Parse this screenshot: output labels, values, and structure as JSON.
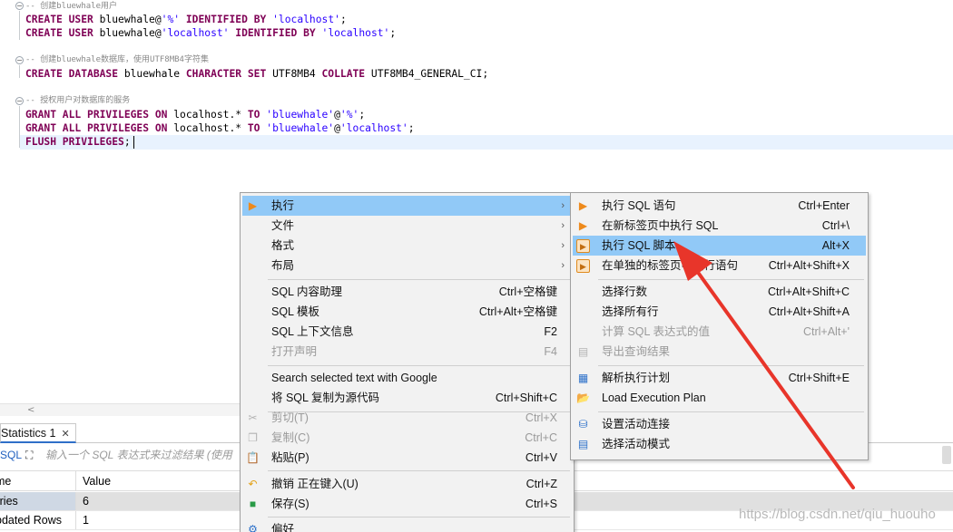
{
  "editor": {
    "lines": [
      {
        "segs": [
          {
            "t": "-- 创建bluewhale用户",
            "c": "cm"
          }
        ]
      },
      {
        "segs": [
          {
            "t": "CREATE USER",
            "c": "kw"
          },
          {
            "t": " bluewhale@",
            "c": ""
          },
          {
            "t": "'%'",
            "c": "str"
          },
          {
            "t": " ",
            "c": ""
          },
          {
            "t": "IDENTIFIED BY",
            "c": "kw"
          },
          {
            "t": " ",
            "c": ""
          },
          {
            "t": "'localhost'",
            "c": "str"
          },
          {
            "t": ";",
            "c": ""
          }
        ]
      },
      {
        "segs": [
          {
            "t": "CREATE USER",
            "c": "kw"
          },
          {
            "t": " bluewhale@",
            "c": ""
          },
          {
            "t": "'localhost'",
            "c": "str"
          },
          {
            "t": " ",
            "c": ""
          },
          {
            "t": "IDENTIFIED BY",
            "c": "kw"
          },
          {
            "t": " ",
            "c": ""
          },
          {
            "t": "'localhost'",
            "c": "str"
          },
          {
            "t": ";",
            "c": ""
          }
        ]
      },
      {
        "segs": []
      },
      {
        "segs": [
          {
            "t": "-- 创建bluewhale数据库，使用UTF8MB4字符集",
            "c": "cm"
          }
        ]
      },
      {
        "segs": [
          {
            "t": "CREATE DATABASE",
            "c": "kw"
          },
          {
            "t": " bluewhale ",
            "c": ""
          },
          {
            "t": "CHARACTER SET",
            "c": "kw"
          },
          {
            "t": " UTF8MB4 ",
            "c": ""
          },
          {
            "t": "COLLATE",
            "c": "kw"
          },
          {
            "t": " UTF8MB4_GENERAL_CI;",
            "c": ""
          }
        ]
      },
      {
        "segs": []
      },
      {
        "segs": [
          {
            "t": "-- 授权用户对数据库的服务",
            "c": "cm"
          }
        ]
      },
      {
        "segs": [
          {
            "t": "GRANT ALL PRIVILEGES ON",
            "c": "kw"
          },
          {
            "t": " localhost.* ",
            "c": ""
          },
          {
            "t": "TO",
            "c": "kw"
          },
          {
            "t": " ",
            "c": ""
          },
          {
            "t": "'bluewhale'",
            "c": "str"
          },
          {
            "t": "@",
            "c": ""
          },
          {
            "t": "'%'",
            "c": "str"
          },
          {
            "t": ";",
            "c": ""
          }
        ]
      },
      {
        "segs": [
          {
            "t": "GRANT ALL PRIVILEGES ON",
            "c": "kw"
          },
          {
            "t": " localhost.* ",
            "c": ""
          },
          {
            "t": "TO",
            "c": "kw"
          },
          {
            "t": " ",
            "c": ""
          },
          {
            "t": "'bluewhale'",
            "c": "str"
          },
          {
            "t": "@",
            "c": ""
          },
          {
            "t": "'localhost'",
            "c": "str"
          },
          {
            "t": ";",
            "c": ""
          }
        ]
      },
      {
        "segs": [
          {
            "t": "FLUSH PRIVILEGES",
            "c": "kw"
          },
          {
            "t": ";",
            "c": ""
          }
        ]
      }
    ]
  },
  "stats_panel": {
    "tab_label": "Statistics 1",
    "tab_close": "✕",
    "filter_sql_label": "SQL",
    "filter_placeholder": "输入一个 SQL 表达式来过滤结果 (使用",
    "columns": {
      "name": "Name",
      "value": "Value"
    },
    "rows": [
      {
        "name": "Queries",
        "value": "6"
      },
      {
        "name": "Updated Rows",
        "value": "1"
      }
    ]
  },
  "context_menu": {
    "items": [
      {
        "label": "执行",
        "shortcut": "",
        "submenu": true,
        "highlighted": true,
        "icon": "run-icon"
      },
      {
        "label": "文件",
        "shortcut": "",
        "submenu": true
      },
      {
        "label": "格式",
        "shortcut": "",
        "submenu": true
      },
      {
        "label": "布局",
        "shortcut": "",
        "submenu": true
      },
      {
        "label": "SQL 内容助理",
        "shortcut": "Ctrl+空格键"
      },
      {
        "label": "SQL 模板",
        "shortcut": "Ctrl+Alt+空格键"
      },
      {
        "label": "SQL 上下文信息",
        "shortcut": "F2"
      },
      {
        "label": "打开声明",
        "shortcut": "F4",
        "disabled": true
      },
      {
        "label": "Search selected text with Google",
        "shortcut": ""
      },
      {
        "label": "将 SQL 复制为源代码",
        "shortcut": "Ctrl+Shift+C"
      },
      {
        "label": "剪切(T)",
        "shortcut": "Ctrl+X",
        "disabled": true,
        "icon": "cut-icon"
      },
      {
        "label": "复制(C)",
        "shortcut": "Ctrl+C",
        "disabled": true,
        "icon": "copy-icon"
      },
      {
        "label": "粘贴(P)",
        "shortcut": "Ctrl+V",
        "icon": "paste-icon"
      },
      {
        "label": "撤销 正在键入(U)",
        "shortcut": "Ctrl+Z",
        "icon": "undo-icon"
      },
      {
        "label": "保存(S)",
        "shortcut": "Ctrl+S",
        "icon": "save-icon"
      },
      {
        "label": "偏好",
        "shortcut": "",
        "icon": "preferences-icon"
      }
    ]
  },
  "submenu": {
    "items": [
      {
        "label": "执行 SQL 语句",
        "shortcut": "Ctrl+Enter",
        "icon": "execute-statement-icon"
      },
      {
        "label": "在新标签页中执行 SQL",
        "shortcut": "Ctrl+\\",
        "icon": "execute-new-tab-icon"
      },
      {
        "label": "执行 SQL 脚本",
        "shortcut": "Alt+X",
        "highlighted": true,
        "icon": "execute-script-icon"
      },
      {
        "label": "在单独的标签页中执行语句",
        "shortcut": "Ctrl+Alt+Shift+X",
        "icon": "execute-separate-tabs-icon"
      },
      {
        "label": "选择行数",
        "shortcut": "Ctrl+Alt+Shift+C"
      },
      {
        "label": "选择所有行",
        "shortcut": "Ctrl+Alt+Shift+A"
      },
      {
        "label": "计算 SQL 表达式的值",
        "shortcut": "Ctrl+Alt+'",
        "disabled": true
      },
      {
        "label": "导出查询结果",
        "shortcut": "",
        "disabled": true,
        "icon": "export-icon"
      },
      {
        "label": "解析执行计划",
        "shortcut": "Ctrl+Shift+E",
        "icon": "explain-plan-icon"
      },
      {
        "label": "Load Execution Plan",
        "shortcut": "",
        "icon": "load-plan-icon"
      },
      {
        "label": "设置活动连接",
        "shortcut": "",
        "icon": "active-connection-icon"
      },
      {
        "label": "选择活动模式",
        "shortcut": "",
        "icon": "active-schema-icon"
      }
    ]
  },
  "watermark": "https://blog.csdn.net/qiu_huouho",
  "colors": {
    "highlight": "#91c9f7",
    "keyword": "#7f0055",
    "string": "#2a00ff",
    "annotation_arrow": "#e8352a"
  }
}
